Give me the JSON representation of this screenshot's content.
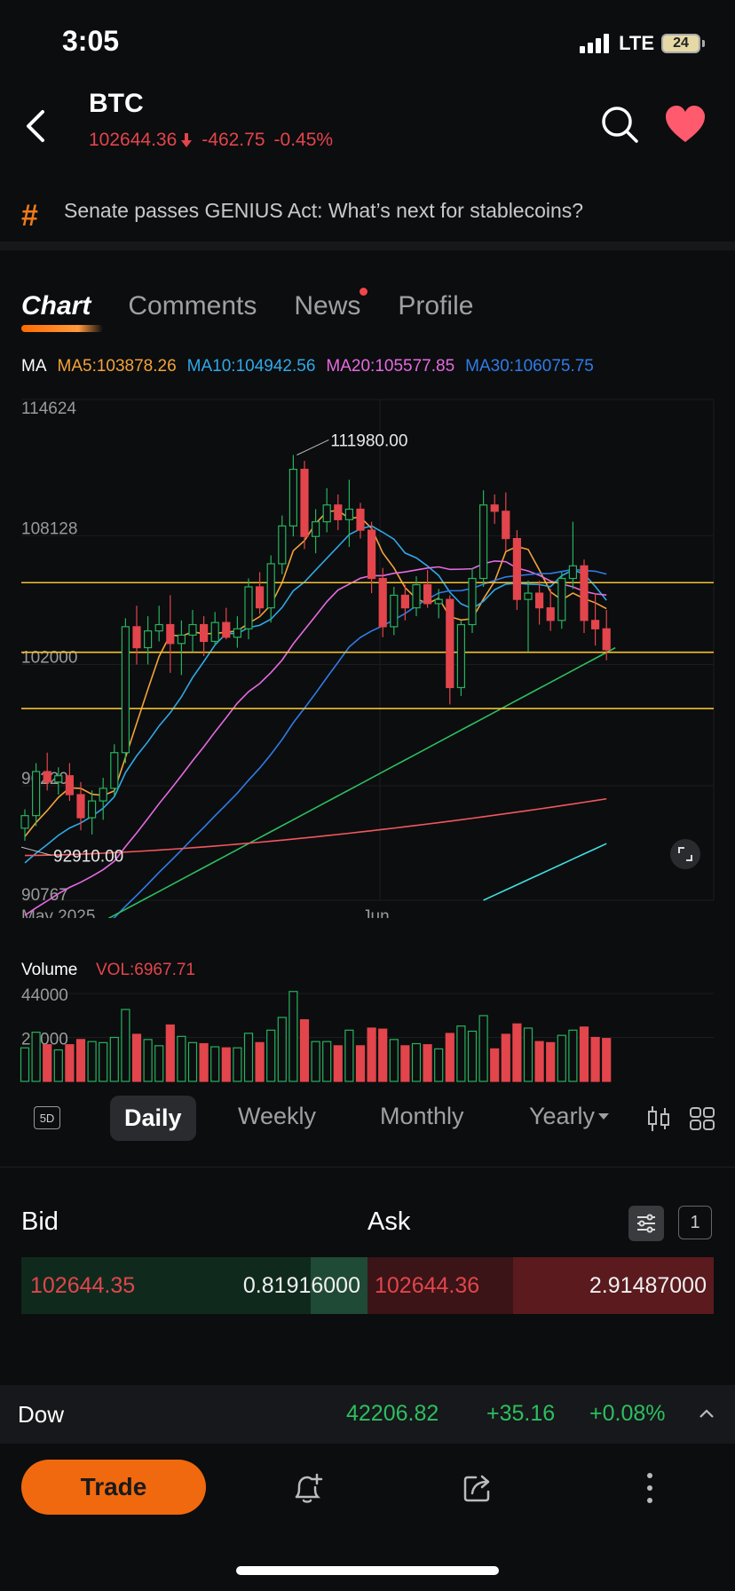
{
  "status": {
    "time": "3:05",
    "network": "LTE",
    "battery": "24"
  },
  "header": {
    "ticker": "BTC",
    "price": "102644.36",
    "change": "-462.75",
    "change_pct": "-0.45%"
  },
  "news_banner": {
    "headline": "Senate passes GENIUS Act: What’s next for stablecoins?"
  },
  "tabs": [
    {
      "label": "Chart",
      "active": true
    },
    {
      "label": "Comments"
    },
    {
      "label": "News",
      "dot": true
    },
    {
      "label": "Profile"
    }
  ],
  "ma_row": {
    "label": "MA",
    "ma5": "MA5:103878.26",
    "ma10": "MA10:104942.56",
    "ma20": "MA20:105577.85",
    "ma30": "MA30:106075.75",
    "colors": {
      "ma5": "#f2a33a",
      "ma10": "#2fa9e8",
      "ma20": "#e56be0",
      "ma30": "#2f7de8"
    }
  },
  "chart_data": {
    "type": "candlestick",
    "title": "",
    "y_ticks": [
      "114624",
      "108128",
      "102000",
      "96220",
      "90767"
    ],
    "x_ticks": [
      "May 2025",
      "Jun"
    ],
    "ylim": [
      90767,
      114624
    ],
    "annotations": [
      {
        "label": "111980.00",
        "type": "high"
      },
      {
        "label": "92910.00",
        "type": "low"
      }
    ],
    "horizontal_levels": [
      105900,
      102580,
      99900
    ],
    "candles": [
      [
        94200,
        95100,
        93600,
        94800
      ],
      [
        94800,
        97300,
        94300,
        96900
      ],
      [
        96900,
        97800,
        96000,
        96400
      ],
      [
        96400,
        97100,
        95800,
        96700
      ],
      [
        96700,
        97300,
        95500,
        95800
      ],
      [
        95800,
        96400,
        94100,
        94700
      ],
      [
        94700,
        96000,
        93900,
        95500
      ],
      [
        95500,
        96600,
        94600,
        96100
      ],
      [
        96100,
        98200,
        95700,
        97800
      ],
      [
        97800,
        104200,
        97300,
        103800
      ],
      [
        103800,
        104800,
        102000,
        102800
      ],
      [
        102800,
        104300,
        102000,
        103600
      ],
      [
        103600,
        104800,
        103100,
        103900
      ],
      [
        103900,
        105300,
        101600,
        103000
      ],
      [
        103000,
        104100,
        101500,
        103400
      ],
      [
        103400,
        104600,
        102600,
        103900
      ],
      [
        103900,
        104300,
        102400,
        103100
      ],
      [
        103100,
        104500,
        102900,
        104000
      ],
      [
        104000,
        104700,
        103200,
        103300
      ],
      [
        103300,
        104300,
        102800,
        103700
      ],
      [
        103700,
        106100,
        103200,
        105700
      ],
      [
        105700,
        106400,
        104400,
        104700
      ],
      [
        104700,
        107200,
        104000,
        106800
      ],
      [
        106800,
        109100,
        106300,
        108600
      ],
      [
        108600,
        111980,
        108100,
        111300
      ],
      [
        111300,
        111700,
        107500,
        108100
      ],
      [
        108100,
        109400,
        107300,
        108800
      ],
      [
        108800,
        110400,
        108300,
        109600
      ],
      [
        109600,
        110100,
        108400,
        108900
      ],
      [
        108900,
        110800,
        107600,
        109400
      ],
      [
        109400,
        109700,
        108000,
        108400
      ],
      [
        108400,
        108800,
        105400,
        106100
      ],
      [
        106100,
        106600,
        103300,
        103800
      ],
      [
        103800,
        105700,
        103400,
        105300
      ],
      [
        105300,
        105800,
        104100,
        104700
      ],
      [
        104700,
        106200,
        104300,
        105800
      ],
      [
        105800,
        106500,
        104700,
        104900
      ],
      [
        104900,
        105600,
        104200,
        105100
      ],
      [
        105100,
        105300,
        100100,
        100900
      ],
      [
        100900,
        104100,
        100500,
        103900
      ],
      [
        103900,
        106600,
        103500,
        106100
      ],
      [
        106100,
        110300,
        105700,
        109600
      ],
      [
        109600,
        110100,
        108700,
        109300
      ],
      [
        109300,
        110200,
        107400,
        108000
      ],
      [
        108000,
        108400,
        104600,
        105100
      ],
      [
        105100,
        106000,
        102600,
        105400
      ],
      [
        105400,
        106000,
        103900,
        104700
      ],
      [
        104700,
        105600,
        103600,
        104100
      ],
      [
        104100,
        106400,
        103700,
        106100
      ],
      [
        106100,
        108800,
        105600,
        106700
      ],
      [
        106700,
        107000,
        103500,
        104100
      ],
      [
        104100,
        105400,
        102900,
        103700
      ],
      [
        103700,
        104600,
        102200,
        102700
      ]
    ]
  },
  "volume": {
    "label": "Volume",
    "value": "VOL:6967.71",
    "y_ticks": [
      "44000",
      "22000"
    ],
    "ymax": 48000
  },
  "periods": {
    "d5": "5D",
    "daily": "Daily",
    "weekly": "Weekly",
    "monthly": "Monthly",
    "yearly": "Yearly"
  },
  "order_book": {
    "bid_label": "Bid",
    "ask_label": "Ask",
    "qty": "1",
    "bid_price": "102644.35",
    "bid_size": "0.81916000",
    "ask_price": "102644.36",
    "ask_size": "2.91487000"
  },
  "index_strip": {
    "name": "Dow",
    "value": "42206.82",
    "change": "+35.16",
    "change_pct": "+0.08%"
  },
  "bottom_bar": {
    "trade_label": "Trade"
  },
  "colors": {
    "up": "#26b35e",
    "down": "#e2454b",
    "accent": "#f0690f",
    "level": "#f2c230"
  }
}
